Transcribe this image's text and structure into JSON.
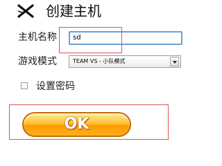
{
  "dialog": {
    "close_icon": "close-icon",
    "title": "创建主机"
  },
  "form": {
    "host_name": {
      "label": "主机名称",
      "value": "sd"
    },
    "game_mode": {
      "label": "游戏模式",
      "selected": "TEAM VS - 小队模式"
    },
    "password": {
      "label": "设置密码",
      "checked": false
    }
  },
  "ok_button": {
    "label": "OK"
  },
  "colors": {
    "ok_button_orange": "#ff9a00",
    "input_border": "#6d9ed6",
    "highlight_red": "#e05050"
  }
}
